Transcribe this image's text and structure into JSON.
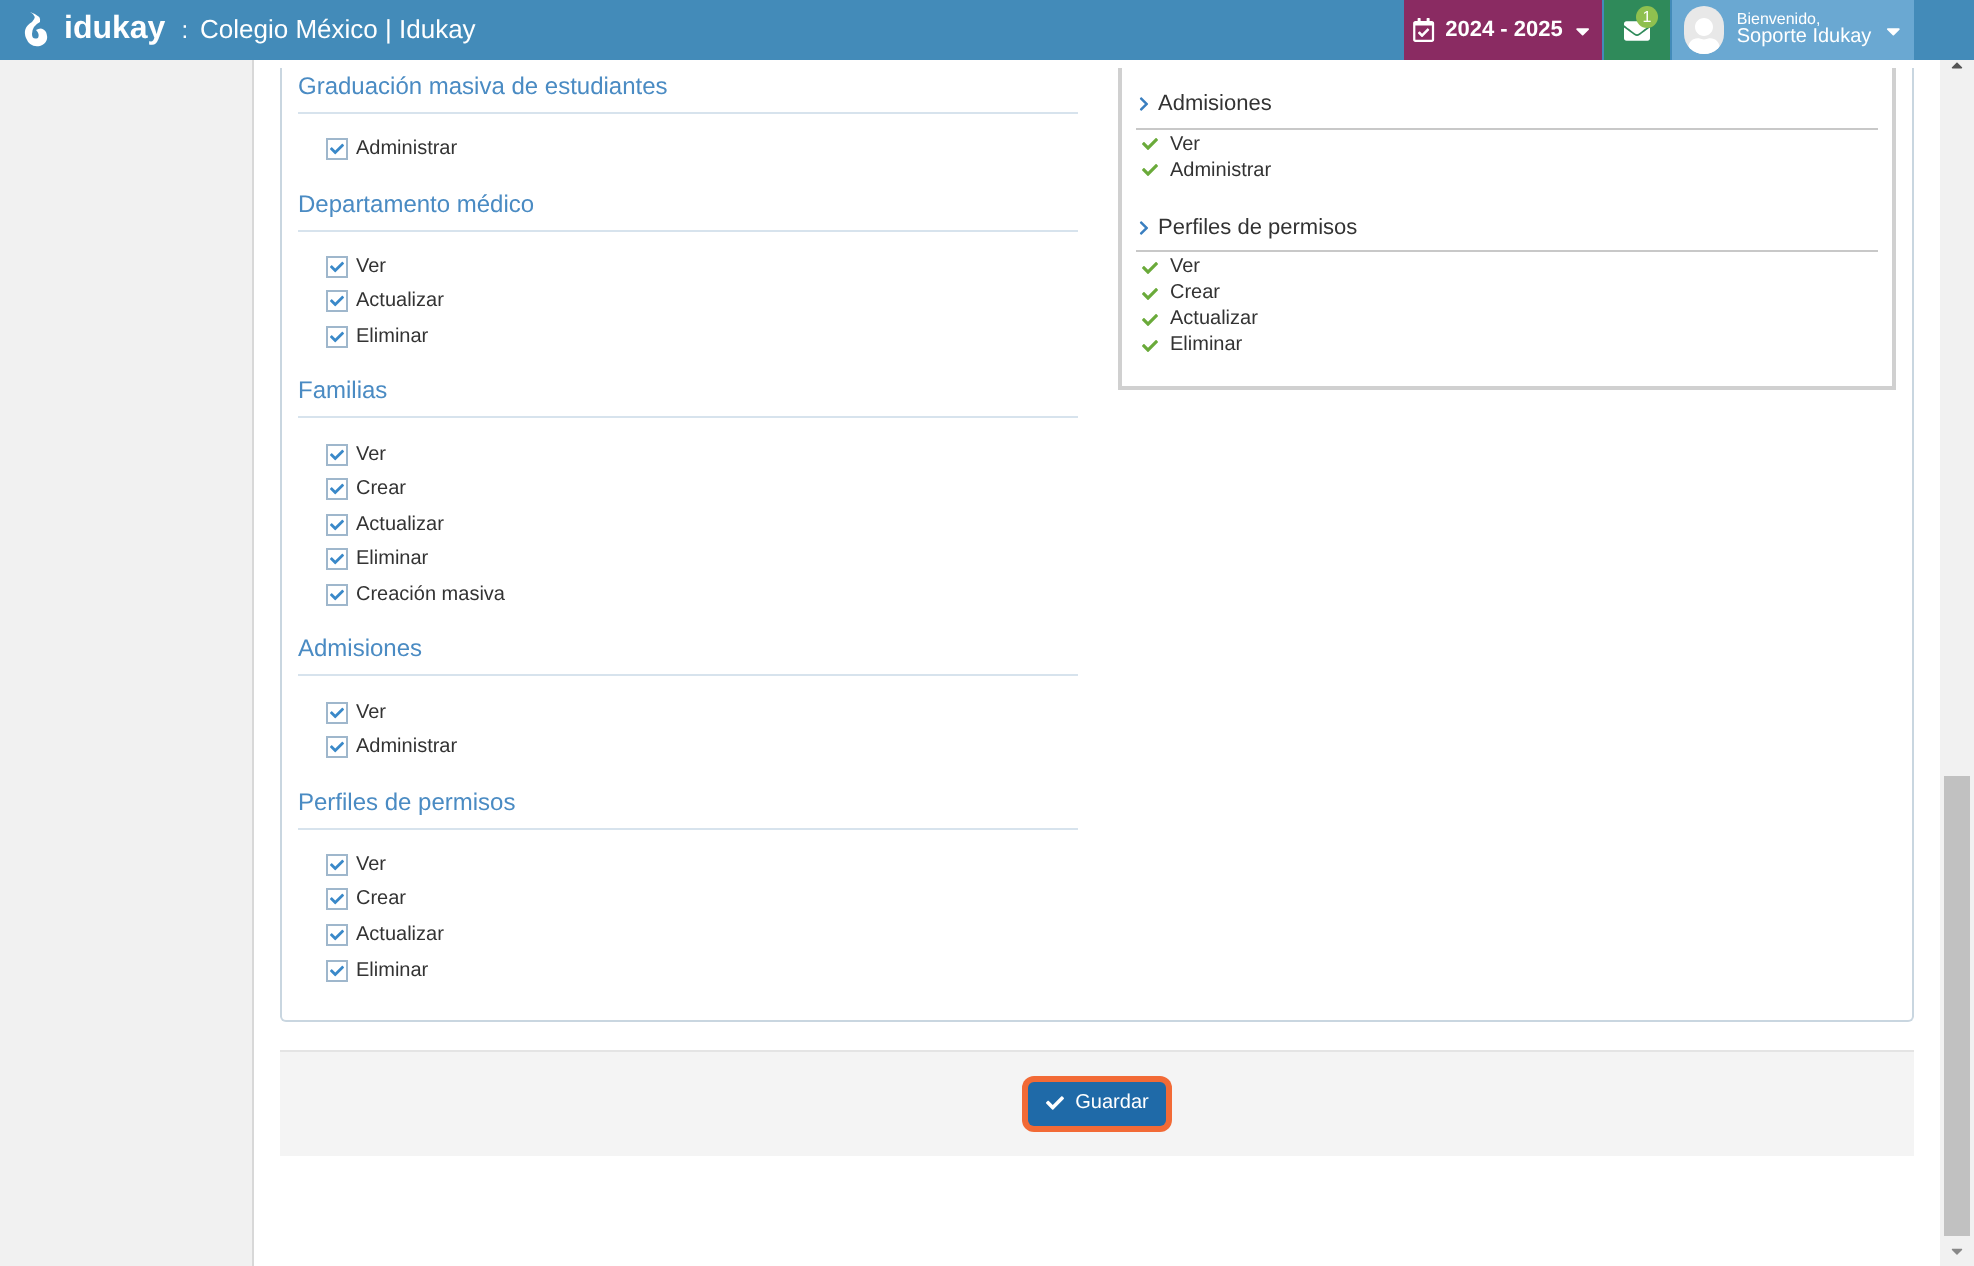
{
  "header": {
    "logo_text": "idukay",
    "separator": ":",
    "school": "Colegio México | Idukay",
    "year": "2024 - 2025",
    "messages_badge": "1",
    "greeting": "Bienvenido,",
    "user": "Soporte Idukay"
  },
  "permission_sections": [
    {
      "title": "Graduación masiva de estudiantes",
      "items": [
        {
          "label": "Administrar",
          "checked": true
        }
      ]
    },
    {
      "title": "Departamento médico",
      "items": [
        {
          "label": "Ver",
          "checked": true
        },
        {
          "label": "Actualizar",
          "checked": true
        },
        {
          "label": "Eliminar",
          "checked": true
        }
      ]
    },
    {
      "title": "Familias",
      "items": [
        {
          "label": "Ver",
          "checked": true
        },
        {
          "label": "Crear",
          "checked": true
        },
        {
          "label": "Actualizar",
          "checked": true
        },
        {
          "label": "Eliminar",
          "checked": true
        },
        {
          "label": "Creación masiva",
          "checked": true
        }
      ]
    },
    {
      "title": "Admisiones",
      "items": [
        {
          "label": "Ver",
          "checked": true
        },
        {
          "label": "Administrar",
          "checked": true
        }
      ]
    },
    {
      "title": "Perfiles de permisos",
      "items": [
        {
          "label": "Ver",
          "checked": true
        },
        {
          "label": "Crear",
          "checked": true
        },
        {
          "label": "Actualizar",
          "checked": true
        },
        {
          "label": "Eliminar",
          "checked": true
        }
      ]
    }
  ],
  "summary_sections": [
    {
      "title": "Admisiones",
      "items": [
        "Ver",
        "Administrar"
      ]
    },
    {
      "title": "Perfiles de permisos",
      "items": [
        "Ver",
        "Crear",
        "Actualizar",
        "Eliminar"
      ]
    }
  ],
  "save_button": "Guardar"
}
